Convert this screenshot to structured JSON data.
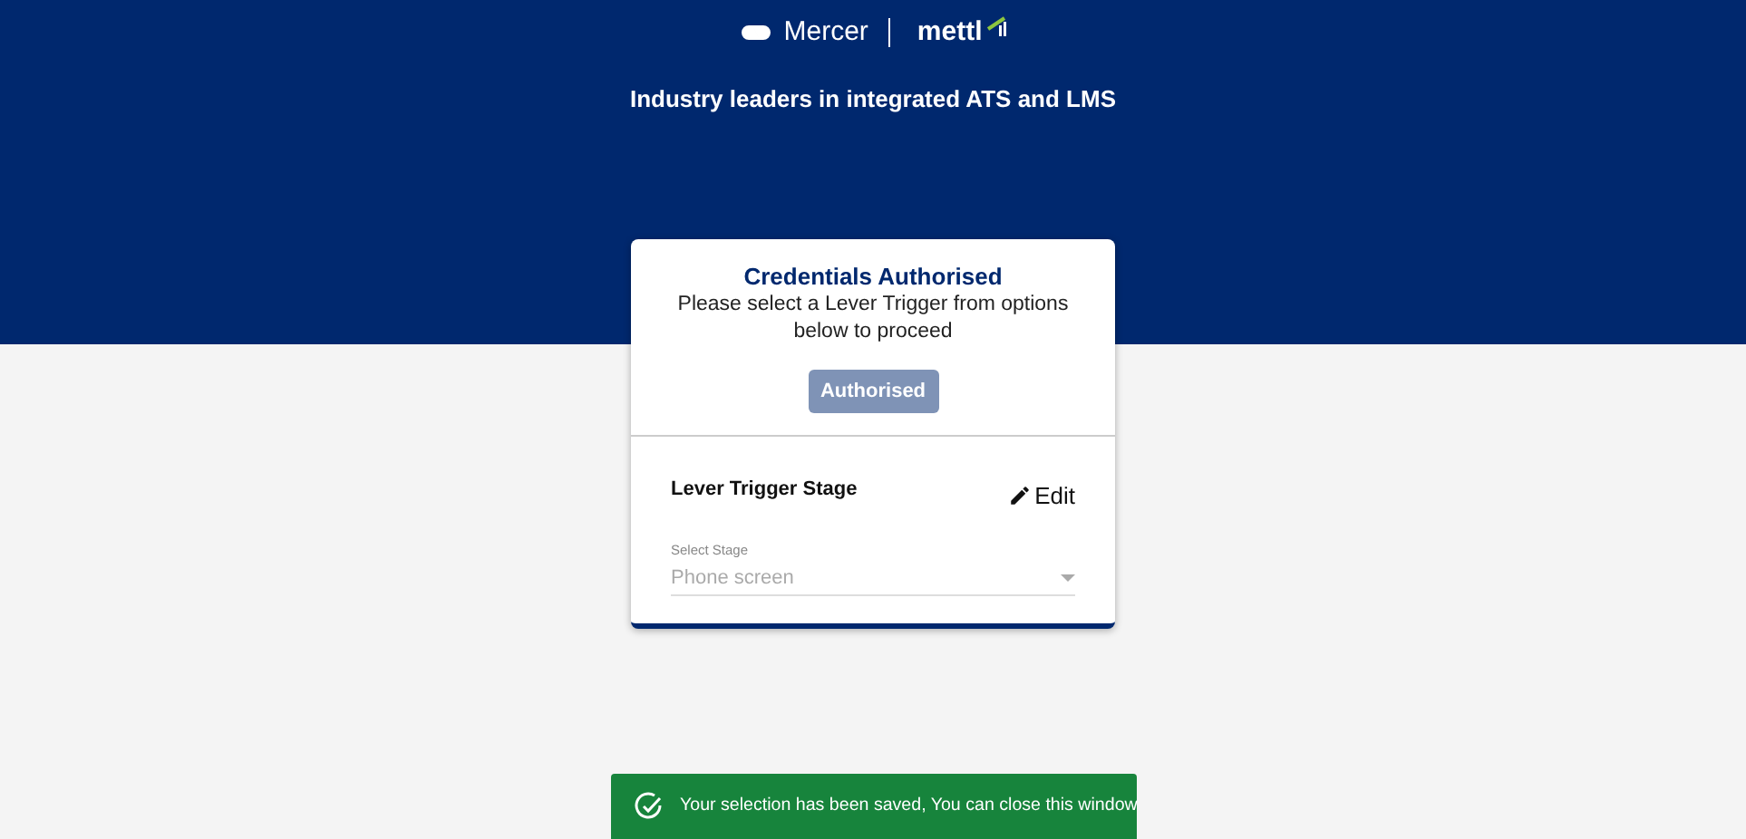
{
  "header": {
    "brand_left": "Mercer",
    "brand_right": "mettl",
    "tagline": "Industry leaders in integrated ATS and LMS"
  },
  "card": {
    "title": "Credentials Authorised",
    "message": "Please select a Lever Trigger from options below to proceed",
    "button": {
      "label": "Authorised",
      "disabled": true
    },
    "section": {
      "title": "Lever Trigger Stage",
      "edit_label": "Edit",
      "select": {
        "label": "Select Stage",
        "value": "Phone screen",
        "disabled": true
      }
    }
  },
  "toast": {
    "message": "Your selection has been saved, You can close this window"
  }
}
